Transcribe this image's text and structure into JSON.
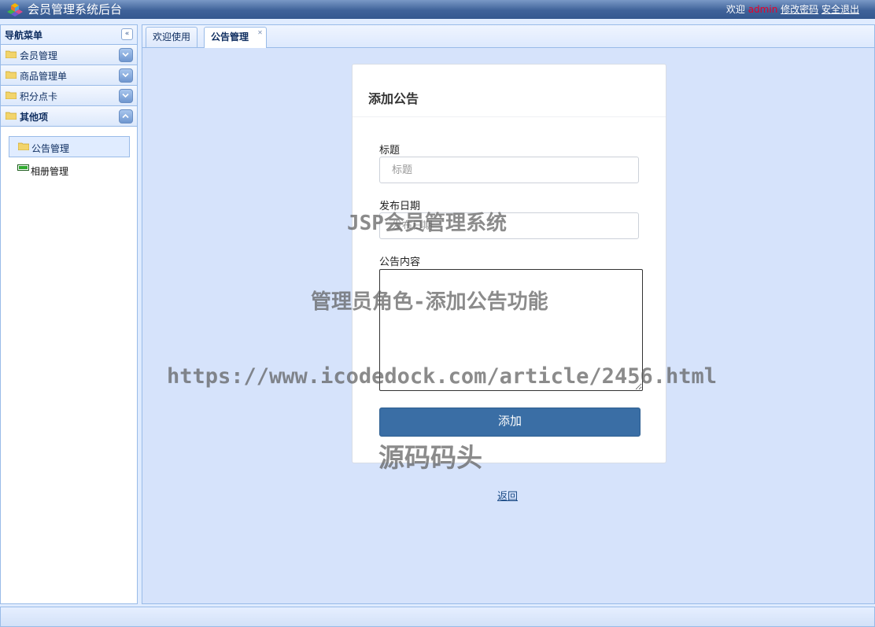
{
  "header": {
    "app_title": "会员管理系统后台",
    "welcome": "欢迎",
    "username": "admin",
    "change_password": "修改密码",
    "logout": "安全退出"
  },
  "nav": {
    "title": "导航菜单",
    "sections": [
      {
        "label": "会员管理",
        "expanded": false
      },
      {
        "label": "商品管理单",
        "expanded": false
      },
      {
        "label": "积分点卡",
        "expanded": false
      },
      {
        "label": "其他项",
        "expanded": true
      }
    ],
    "sub_items": [
      {
        "label": "公告管理",
        "selected": true
      },
      {
        "label": "相册管理",
        "selected": false
      }
    ]
  },
  "tabs": [
    {
      "label": "欢迎使用"
    },
    {
      "label": "公告管理",
      "closable": true
    }
  ],
  "form": {
    "heading": "添加公告",
    "title_label": "标题",
    "title_placeholder": "标题",
    "date_label": "发布日期",
    "date_placeholder": "发布日期",
    "content_label": "公告内容",
    "submit_label": "添加",
    "back_label": "返回"
  },
  "watermarks": [
    "JSP会员管理系统",
    "管理员角色-添加公告功能",
    "https://www.icodedock.com/article/2456.html",
    "源码码头"
  ],
  "colors": {
    "header_bg": "#3f6299",
    "panel_bg": "#d6e3fb",
    "button_bg": "#3a6ea5",
    "username": "#e8002a"
  }
}
